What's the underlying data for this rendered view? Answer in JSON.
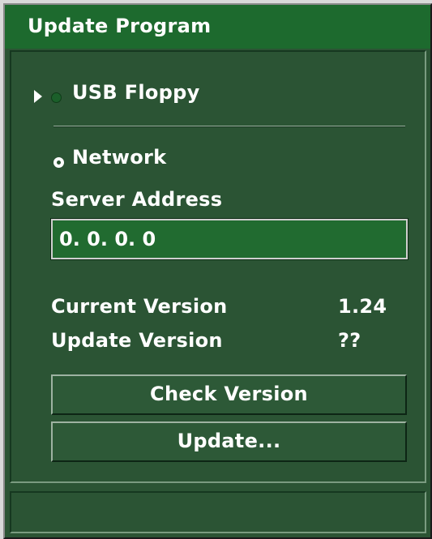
{
  "window": {
    "title": "Update Program"
  },
  "source": {
    "usb_label": "USB Floppy",
    "network_label": "Network",
    "selected": "Network"
  },
  "server": {
    "label": "Server Address",
    "value": "0. 0. 0. 0"
  },
  "versions": {
    "current_label": "Current Version",
    "current_value": "1.24",
    "update_label": "Update Version",
    "update_value": "??"
  },
  "buttons": {
    "check_version": "Check Version",
    "update": "Update..."
  },
  "status": {
    "text": ""
  },
  "colors": {
    "panel_bg": "#2b5434",
    "titlebar_bg": "#1d6a2e",
    "input_bg": "#216b30",
    "text": "#ffffff"
  },
  "icons": {
    "focus": "focus-arrow-icon",
    "radio_unselected": "radio-unselected-icon",
    "radio_selected": "radio-selected-icon"
  }
}
